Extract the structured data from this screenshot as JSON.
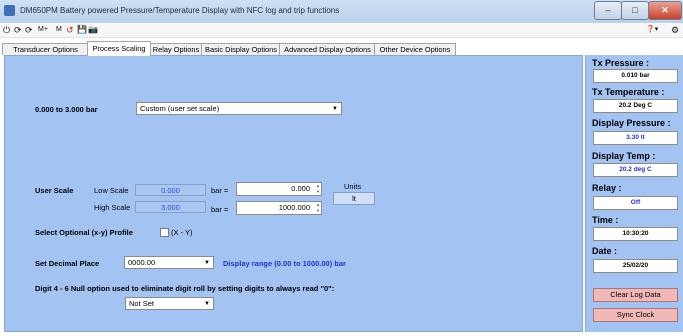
{
  "window": {
    "title": "DM650PM Battery powered Pressure/Temperature Display with NFC log and trip functions",
    "minimize": "–",
    "maximize": "□",
    "close": "✕"
  },
  "toolbar": {
    "items": [
      "⏻",
      "⟳",
      "⟳",
      "M+",
      "M",
      "↺",
      "💾",
      "📷"
    ],
    "help": "❓▾",
    "extra": "⚙"
  },
  "tabs": [
    {
      "label": "Transducer Options",
      "active": false
    },
    {
      "label": "Process Scaling",
      "active": true
    },
    {
      "label": "Relay Options",
      "active": false
    },
    {
      "label": "Basic Display Options",
      "active": false
    },
    {
      "label": "Advanced Display Options",
      "active": false
    },
    {
      "label": "Other Device Options",
      "active": false
    }
  ],
  "process": {
    "range_label": "0.000 to 3.000 bar",
    "scale_select": "Custom (user set scale)",
    "user_scale_label": "User Scale",
    "low_scale_label": "Low Scale",
    "low_scale_value": "0.000",
    "high_scale_label": "High Scale",
    "high_scale_value": "3.000",
    "bar_eq": "bar =",
    "low_display_value": "0.000",
    "high_display_value": "1000.000",
    "units_label": "Units",
    "units_value": "lt",
    "profile_label": "Select Optional (x-y) Profile",
    "profile_checkbox_label": "(X - Y)",
    "decimal_label": "Set Decimal Place",
    "decimal_select": "0000.00",
    "display_range": "Display range (0.00 to 1000.00)  bar",
    "null_label": "Digit 4 - 6  Null option used to eliminate digit roll by setting digits to always read \"0\":",
    "null_select": "Not Set"
  },
  "readings": {
    "tx_pressure_label": "Tx  Pressure :",
    "tx_pressure_value": "0.010 bar",
    "tx_temp_label": "Tx Temperature :",
    "tx_temp_value": "20.2 Deg C",
    "disp_pressure_label": "Display Pressure :",
    "disp_pressure_value": "3.30 lt",
    "disp_temp_label": "Display Temp :",
    "disp_temp_value": "20.2 deg C",
    "relay_label": "Relay :",
    "relay_value": "Off",
    "time_label": "Time :",
    "time_value": "10:30:20",
    "date_label": "Date :",
    "date_value": "25/02/20",
    "clear_log": "Clear Log Data",
    "sync_clock": "Sync Clock"
  },
  "colors": {
    "panel": "#a3c3f3",
    "value_blue": "#2233cc",
    "button_pink": "#f2b8b8"
  }
}
